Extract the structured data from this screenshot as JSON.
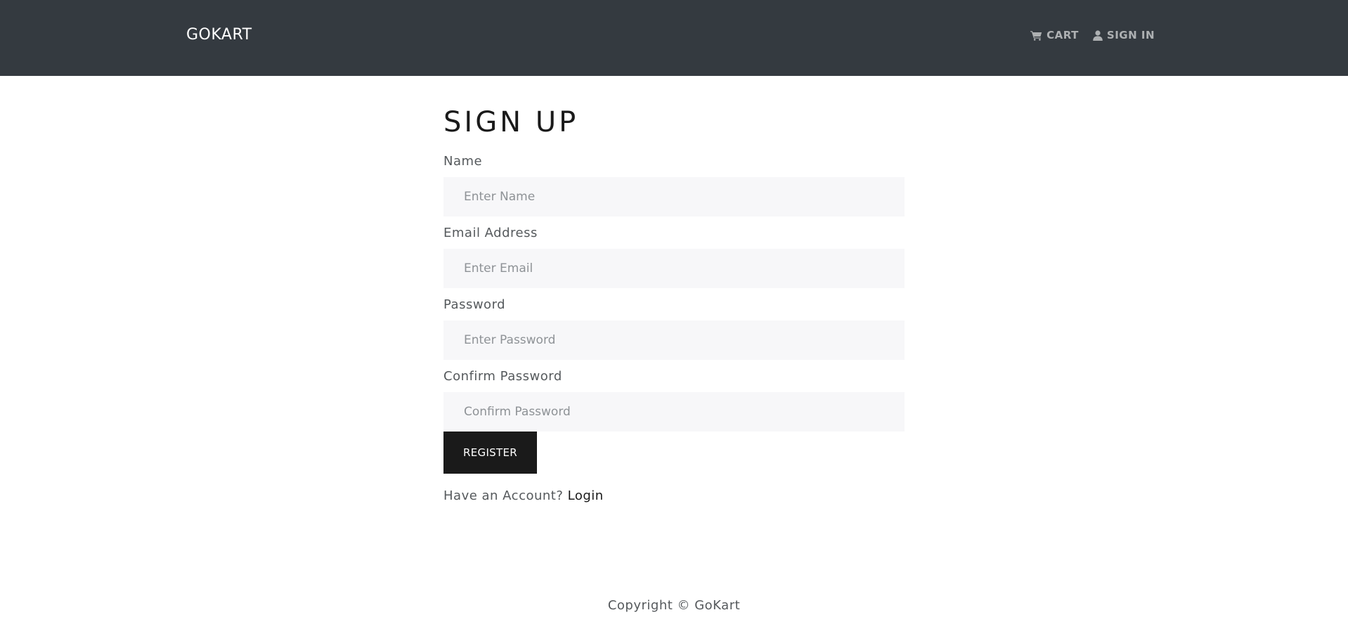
{
  "header": {
    "brand": "GOKART",
    "nav": [
      {
        "label": "CART",
        "icon": "cart-icon"
      },
      {
        "label": "SIGN IN",
        "icon": "user-icon"
      }
    ]
  },
  "form": {
    "title": "SIGN UP",
    "fields": [
      {
        "label": "Name",
        "placeholder": "Enter Name",
        "value": ""
      },
      {
        "label": "Email Address",
        "placeholder": "Enter Email",
        "value": ""
      },
      {
        "label": "Password",
        "placeholder": "Enter Password",
        "value": ""
      },
      {
        "label": "Confirm Password",
        "placeholder": "Confirm Password",
        "value": ""
      }
    ],
    "submit_label": "REGISTER",
    "account_prompt": "Have an Account?",
    "login_label": "Login"
  },
  "footer": {
    "copyright": "Copyright © GoKart"
  },
  "colors": {
    "navbar_bg": "#343a40",
    "input_bg": "#f7f7f9",
    "button_bg": "#1a1a1a",
    "text": "#55595c"
  }
}
